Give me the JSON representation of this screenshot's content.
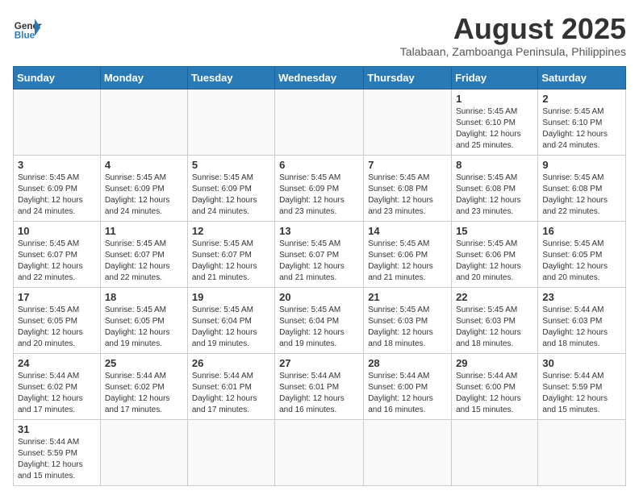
{
  "header": {
    "logo_general": "General",
    "logo_blue": "Blue",
    "month_year": "August 2025",
    "location": "Talabaan, Zamboanga Peninsula, Philippines"
  },
  "weekdays": [
    "Sunday",
    "Monday",
    "Tuesday",
    "Wednesday",
    "Thursday",
    "Friday",
    "Saturday"
  ],
  "weeks": [
    [
      {
        "day": "",
        "info": ""
      },
      {
        "day": "",
        "info": ""
      },
      {
        "day": "",
        "info": ""
      },
      {
        "day": "",
        "info": ""
      },
      {
        "day": "",
        "info": ""
      },
      {
        "day": "1",
        "info": "Sunrise: 5:45 AM\nSunset: 6:10 PM\nDaylight: 12 hours and 25 minutes."
      },
      {
        "day": "2",
        "info": "Sunrise: 5:45 AM\nSunset: 6:10 PM\nDaylight: 12 hours and 24 minutes."
      }
    ],
    [
      {
        "day": "3",
        "info": "Sunrise: 5:45 AM\nSunset: 6:09 PM\nDaylight: 12 hours and 24 minutes."
      },
      {
        "day": "4",
        "info": "Sunrise: 5:45 AM\nSunset: 6:09 PM\nDaylight: 12 hours and 24 minutes."
      },
      {
        "day": "5",
        "info": "Sunrise: 5:45 AM\nSunset: 6:09 PM\nDaylight: 12 hours and 24 minutes."
      },
      {
        "day": "6",
        "info": "Sunrise: 5:45 AM\nSunset: 6:09 PM\nDaylight: 12 hours and 23 minutes."
      },
      {
        "day": "7",
        "info": "Sunrise: 5:45 AM\nSunset: 6:08 PM\nDaylight: 12 hours and 23 minutes."
      },
      {
        "day": "8",
        "info": "Sunrise: 5:45 AM\nSunset: 6:08 PM\nDaylight: 12 hours and 23 minutes."
      },
      {
        "day": "9",
        "info": "Sunrise: 5:45 AM\nSunset: 6:08 PM\nDaylight: 12 hours and 22 minutes."
      }
    ],
    [
      {
        "day": "10",
        "info": "Sunrise: 5:45 AM\nSunset: 6:07 PM\nDaylight: 12 hours and 22 minutes."
      },
      {
        "day": "11",
        "info": "Sunrise: 5:45 AM\nSunset: 6:07 PM\nDaylight: 12 hours and 22 minutes."
      },
      {
        "day": "12",
        "info": "Sunrise: 5:45 AM\nSunset: 6:07 PM\nDaylight: 12 hours and 21 minutes."
      },
      {
        "day": "13",
        "info": "Sunrise: 5:45 AM\nSunset: 6:07 PM\nDaylight: 12 hours and 21 minutes."
      },
      {
        "day": "14",
        "info": "Sunrise: 5:45 AM\nSunset: 6:06 PM\nDaylight: 12 hours and 21 minutes."
      },
      {
        "day": "15",
        "info": "Sunrise: 5:45 AM\nSunset: 6:06 PM\nDaylight: 12 hours and 20 minutes."
      },
      {
        "day": "16",
        "info": "Sunrise: 5:45 AM\nSunset: 6:05 PM\nDaylight: 12 hours and 20 minutes."
      }
    ],
    [
      {
        "day": "17",
        "info": "Sunrise: 5:45 AM\nSunset: 6:05 PM\nDaylight: 12 hours and 20 minutes."
      },
      {
        "day": "18",
        "info": "Sunrise: 5:45 AM\nSunset: 6:05 PM\nDaylight: 12 hours and 19 minutes."
      },
      {
        "day": "19",
        "info": "Sunrise: 5:45 AM\nSunset: 6:04 PM\nDaylight: 12 hours and 19 minutes."
      },
      {
        "day": "20",
        "info": "Sunrise: 5:45 AM\nSunset: 6:04 PM\nDaylight: 12 hours and 19 minutes."
      },
      {
        "day": "21",
        "info": "Sunrise: 5:45 AM\nSunset: 6:03 PM\nDaylight: 12 hours and 18 minutes."
      },
      {
        "day": "22",
        "info": "Sunrise: 5:45 AM\nSunset: 6:03 PM\nDaylight: 12 hours and 18 minutes."
      },
      {
        "day": "23",
        "info": "Sunrise: 5:44 AM\nSunset: 6:03 PM\nDaylight: 12 hours and 18 minutes."
      }
    ],
    [
      {
        "day": "24",
        "info": "Sunrise: 5:44 AM\nSunset: 6:02 PM\nDaylight: 12 hours and 17 minutes."
      },
      {
        "day": "25",
        "info": "Sunrise: 5:44 AM\nSunset: 6:02 PM\nDaylight: 12 hours and 17 minutes."
      },
      {
        "day": "26",
        "info": "Sunrise: 5:44 AM\nSunset: 6:01 PM\nDaylight: 12 hours and 17 minutes."
      },
      {
        "day": "27",
        "info": "Sunrise: 5:44 AM\nSunset: 6:01 PM\nDaylight: 12 hours and 16 minutes."
      },
      {
        "day": "28",
        "info": "Sunrise: 5:44 AM\nSunset: 6:00 PM\nDaylight: 12 hours and 16 minutes."
      },
      {
        "day": "29",
        "info": "Sunrise: 5:44 AM\nSunset: 6:00 PM\nDaylight: 12 hours and 15 minutes."
      },
      {
        "day": "30",
        "info": "Sunrise: 5:44 AM\nSunset: 5:59 PM\nDaylight: 12 hours and 15 minutes."
      }
    ],
    [
      {
        "day": "31",
        "info": "Sunrise: 5:44 AM\nSunset: 5:59 PM\nDaylight: 12 hours and 15 minutes."
      },
      {
        "day": "",
        "info": ""
      },
      {
        "day": "",
        "info": ""
      },
      {
        "day": "",
        "info": ""
      },
      {
        "day": "",
        "info": ""
      },
      {
        "day": "",
        "info": ""
      },
      {
        "day": "",
        "info": ""
      }
    ]
  ]
}
